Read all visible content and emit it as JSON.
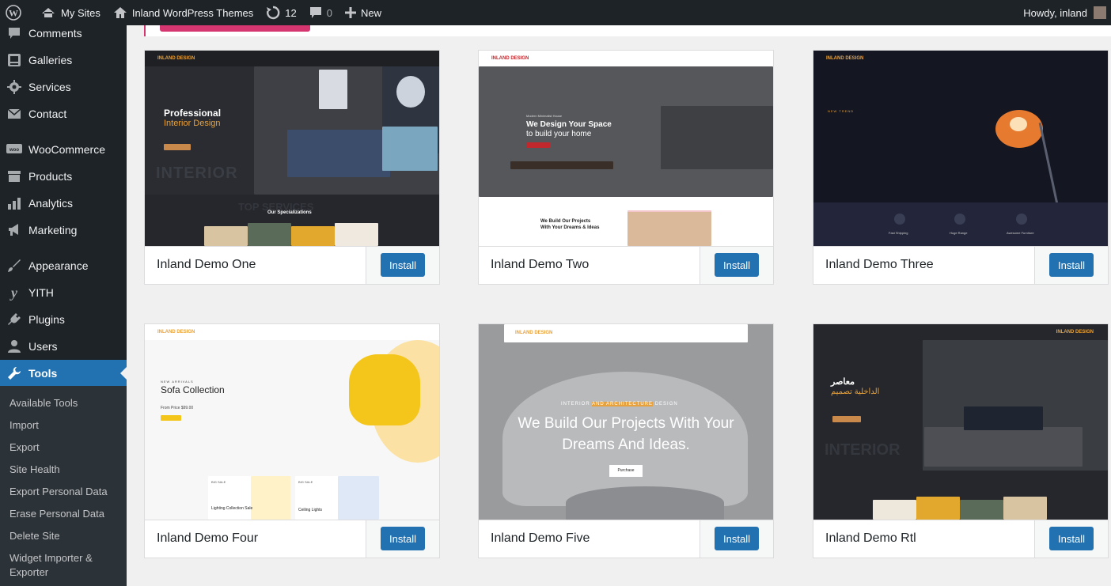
{
  "adminbar": {
    "my_sites": "My Sites",
    "site_name": "Inland WordPress Themes",
    "updates_count": "12",
    "comments_count": "0",
    "new_label": "New",
    "howdy": "Howdy, inland"
  },
  "sidebar": {
    "items": [
      {
        "label": "Comments",
        "icon": "comment-icon"
      },
      {
        "label": "Galleries",
        "icon": "gallery-icon"
      },
      {
        "label": "Services",
        "icon": "gear-icon"
      },
      {
        "label": "Contact",
        "icon": "mail-icon"
      },
      {
        "label": "WooCommerce",
        "icon": "woo-icon"
      },
      {
        "label": "Products",
        "icon": "archive-icon"
      },
      {
        "label": "Analytics",
        "icon": "bar-chart-icon"
      },
      {
        "label": "Marketing",
        "icon": "megaphone-icon"
      },
      {
        "label": "Appearance",
        "icon": "brush-icon"
      },
      {
        "label": "YITH",
        "icon": "yith-icon"
      },
      {
        "label": "Plugins",
        "icon": "plug-icon"
      },
      {
        "label": "Users",
        "icon": "user-icon"
      },
      {
        "label": "Tools",
        "icon": "wrench-icon"
      }
    ],
    "submenu": [
      "Available Tools",
      "Import",
      "Export",
      "Site Health",
      "Export Personal Data",
      "Erase Personal Data",
      "Delete Site",
      "Widget Importer & Exporter"
    ]
  },
  "demos": [
    {
      "name": "Inland Demo One",
      "install": "Install",
      "preview": {
        "logo": "INLAND DESIGN",
        "headline1": "Professional",
        "headline2": "Interior Design",
        "watermark": "INTERIOR",
        "sub": "Our Specializations",
        "bg_text": "TOP SERVICES"
      }
    },
    {
      "name": "Inland Demo Two",
      "install": "Install",
      "preview": {
        "logo": "INLAND DESIGN",
        "eyebrow": "Modern Minimalist House",
        "headline1": "We Design Your Space",
        "headline2": "to build your home",
        "sub1": "We Build Our Projects",
        "sub2": "With Your Dreams & Ideas"
      }
    },
    {
      "name": "Inland Demo Three",
      "install": "Install",
      "preview": {
        "logo": "INLAND DESIGN",
        "eyebrow": "NEW TREND",
        "feature1": "Fast Shipping",
        "feature2": "Huge Range",
        "feature3": "Awesome Furniture"
      }
    },
    {
      "name": "Inland Demo Four",
      "install": "Install",
      "preview": {
        "logo": "INLAND DESIGN",
        "eyebrow": "NEW ARRIVALS",
        "headline": "Sofa Collection",
        "price": "From Price $99.00",
        "promo_tag1": "BIG SALE",
        "promo1": "Lighting Collection Sale",
        "promo_tag2": "BIG SALE",
        "promo2": "Ceiling Lights"
      }
    },
    {
      "name": "Inland Demo Five",
      "install": "Install",
      "preview": {
        "logo": "INLAND DESIGN",
        "eyebrow_a": "INTERIOR",
        "eyebrow_b": "AND ARCHITECTURE",
        "eyebrow_c": "DESIGN",
        "headline1": "We Build Our Projects With Your",
        "headline2": "Dreams And Ideas.",
        "button": "Purchase"
      }
    },
    {
      "name": "Inland Demo Rtl",
      "install": "Install",
      "preview": {
        "logo": "INLAND DESIGN",
        "headline1": "معاصر",
        "headline2": "الداخلية تصميم",
        "watermark": "INTERIOR"
      }
    }
  ],
  "colors": {
    "admin_dark": "#1d2327",
    "submenu_bg": "#2c3338",
    "accent_blue": "#2271b1",
    "accent_pink": "#d63670",
    "page_bg": "#f0f0f1"
  }
}
